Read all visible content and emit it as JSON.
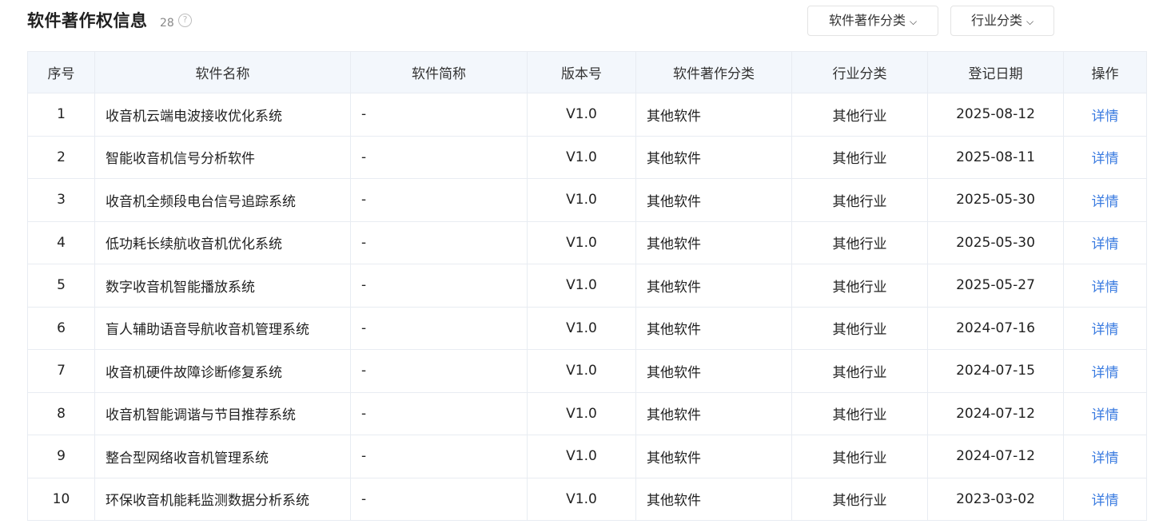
{
  "header": {
    "title": "软件著作权信息",
    "count": "28",
    "help_icon": "?",
    "filters": [
      {
        "label": "软件著作分类",
        "icon": "chevron-down-icon"
      },
      {
        "label": "行业分类",
        "icon": "chevron-down-icon"
      }
    ]
  },
  "table": {
    "columns": [
      "序号",
      "软件名称",
      "软件简称",
      "版本号",
      "软件著作分类",
      "行业分类",
      "登记日期",
      "操作"
    ],
    "rows": [
      {
        "no": "1",
        "name": "收音机云端电波接收优化系统",
        "abbr": "-",
        "version": "V1.0",
        "category": "其他软件",
        "industry": "其他行业",
        "date": "2025-08-12",
        "action": "详情"
      },
      {
        "no": "2",
        "name": "智能收音机信号分析软件",
        "abbr": "-",
        "version": "V1.0",
        "category": "其他软件",
        "industry": "其他行业",
        "date": "2025-08-11",
        "action": "详情"
      },
      {
        "no": "3",
        "name": "收音机全频段电台信号追踪系统",
        "abbr": "-",
        "version": "V1.0",
        "category": "其他软件",
        "industry": "其他行业",
        "date": "2025-05-30",
        "action": "详情"
      },
      {
        "no": "4",
        "name": "低功耗长续航收音机优化系统",
        "abbr": "-",
        "version": "V1.0",
        "category": "其他软件",
        "industry": "其他行业",
        "date": "2025-05-30",
        "action": "详情"
      },
      {
        "no": "5",
        "name": "数字收音机智能播放系统",
        "abbr": "-",
        "version": "V1.0",
        "category": "其他软件",
        "industry": "其他行业",
        "date": "2025-05-27",
        "action": "详情"
      },
      {
        "no": "6",
        "name": "盲人辅助语音导航收音机管理系统",
        "abbr": "-",
        "version": "V1.0",
        "category": "其他软件",
        "industry": "其他行业",
        "date": "2024-07-16",
        "action": "详情"
      },
      {
        "no": "7",
        "name": "收音机硬件故障诊断修复系统",
        "abbr": "-",
        "version": "V1.0",
        "category": "其他软件",
        "industry": "其他行业",
        "date": "2024-07-15",
        "action": "详情"
      },
      {
        "no": "8",
        "name": "收音机智能调谐与节目推荐系统",
        "abbr": "-",
        "version": "V1.0",
        "category": "其他软件",
        "industry": "其他行业",
        "date": "2024-07-12",
        "action": "详情"
      },
      {
        "no": "9",
        "name": "整合型网络收音机管理系统",
        "abbr": "-",
        "version": "V1.0",
        "category": "其他软件",
        "industry": "其他行业",
        "date": "2024-07-12",
        "action": "详情"
      },
      {
        "no": "10",
        "name": "环保收音机能耗监测数据分析系统",
        "abbr": "-",
        "version": "V1.0",
        "category": "其他软件",
        "industry": "其他行业",
        "date": "2023-03-02",
        "action": "详情"
      }
    ]
  },
  "colors": {
    "link": "#3a7be0",
    "header_bg": "#f3f7fc",
    "border": "#e8ecf2"
  }
}
